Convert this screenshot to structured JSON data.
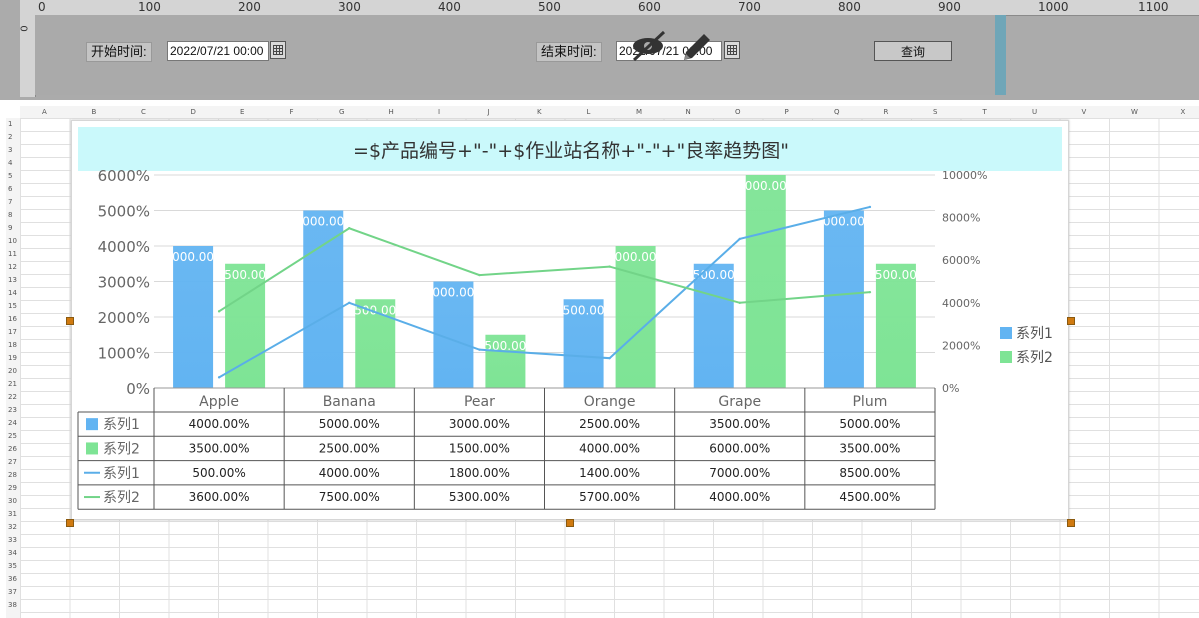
{
  "ruler": {
    "marks": [
      "0",
      "100",
      "200",
      "300",
      "400",
      "500",
      "600",
      "700",
      "800",
      "900",
      "1000",
      "1100"
    ],
    "vmark": "0"
  },
  "params": {
    "start_label": "开始时间:",
    "start_value": "2022/07/21 00:00",
    "end_label": "结束时间:",
    "end_value": "2022/07/21 00:00",
    "query_label": "查询"
  },
  "sheet": {
    "columns": [
      "A",
      "B",
      "C",
      "D",
      "E",
      "F",
      "G",
      "H",
      "I",
      "J",
      "K",
      "L",
      "M",
      "N",
      "O",
      "P",
      "Q",
      "R",
      "S",
      "T",
      "U",
      "V",
      "W",
      "X"
    ],
    "rows": [
      "1",
      "2",
      "3",
      "4",
      "5",
      "6",
      "7",
      "8",
      "9",
      "10",
      "11",
      "12",
      "13",
      "14",
      "15",
      "16",
      "17",
      "18",
      "19",
      "20",
      "21",
      "22",
      "23",
      "24",
      "25",
      "26",
      "27",
      "28",
      "29",
      "30",
      "31",
      "32",
      "33",
      "34",
      "35",
      "36",
      "37",
      "38"
    ]
  },
  "chart_data": {
    "type": "bar",
    "title": "=$产品编号+\"-\"+$作业站名称+\"-\"+\"良率趋势图\"",
    "categories": [
      "Apple",
      "Banana",
      "Pear",
      "Orange",
      "Grape",
      "Plum"
    ],
    "bar_series": [
      {
        "name": "系列1",
        "values": [
          4000,
          5000,
          3000,
          2500,
          3500,
          5000
        ],
        "color": "#62b4f2"
      },
      {
        "name": "系列2",
        "values": [
          3500,
          2500,
          1500,
          4000,
          6000,
          3500
        ],
        "color": "#7ee495"
      }
    ],
    "line_series": [
      {
        "name": "系列1",
        "values": [
          500,
          4000,
          1800,
          1400,
          7000,
          8500
        ],
        "color": "#5aaee8"
      },
      {
        "name": "系列2",
        "values": [
          3600,
          7500,
          5300,
          5700,
          4000,
          4500
        ],
        "color": "#72d488"
      }
    ],
    "bar_labels": [
      "000.00",
      "500.00",
      "000.00",
      "500.00",
      "000.00",
      "500.00",
      "500.00",
      "000.00",
      "500.00",
      "000.00",
      "000.00",
      "500.00"
    ],
    "y_left": {
      "ticks": [
        "0%",
        "1000%",
        "2000%",
        "3000%",
        "4000%",
        "5000%",
        "6000%"
      ],
      "max": 6000
    },
    "y_right": {
      "ticks": [
        "0%",
        "2000%",
        "4000%",
        "6000%",
        "8000%",
        "10000%"
      ],
      "max": 10000
    },
    "legend": {
      "position": "right",
      "items": [
        "系列1",
        "系列2"
      ]
    },
    "table": {
      "rows": [
        {
          "label": "系列1",
          "kind": "bar",
          "color": "#62b4f2",
          "cells": [
            "4000.00%",
            "5000.00%",
            "3000.00%",
            "2500.00%",
            "3500.00%",
            "5000.00%"
          ]
        },
        {
          "label": "系列2",
          "kind": "bar",
          "color": "#7ee495",
          "cells": [
            "3500.00%",
            "2500.00%",
            "1500.00%",
            "4000.00%",
            "6000.00%",
            "3500.00%"
          ]
        },
        {
          "label": "系列1",
          "kind": "line",
          "color": "#5aaee8",
          "cells": [
            "500.00%",
            "4000.00%",
            "1800.00%",
            "1400.00%",
            "7000.00%",
            "8500.00%"
          ]
        },
        {
          "label": "系列2",
          "kind": "line",
          "color": "#72d488",
          "cells": [
            "3600.00%",
            "7500.00%",
            "5300.00%",
            "5700.00%",
            "4000.00%",
            "4500.00%"
          ]
        }
      ]
    },
    "grid": true,
    "title_bg": "#caf9fb"
  }
}
